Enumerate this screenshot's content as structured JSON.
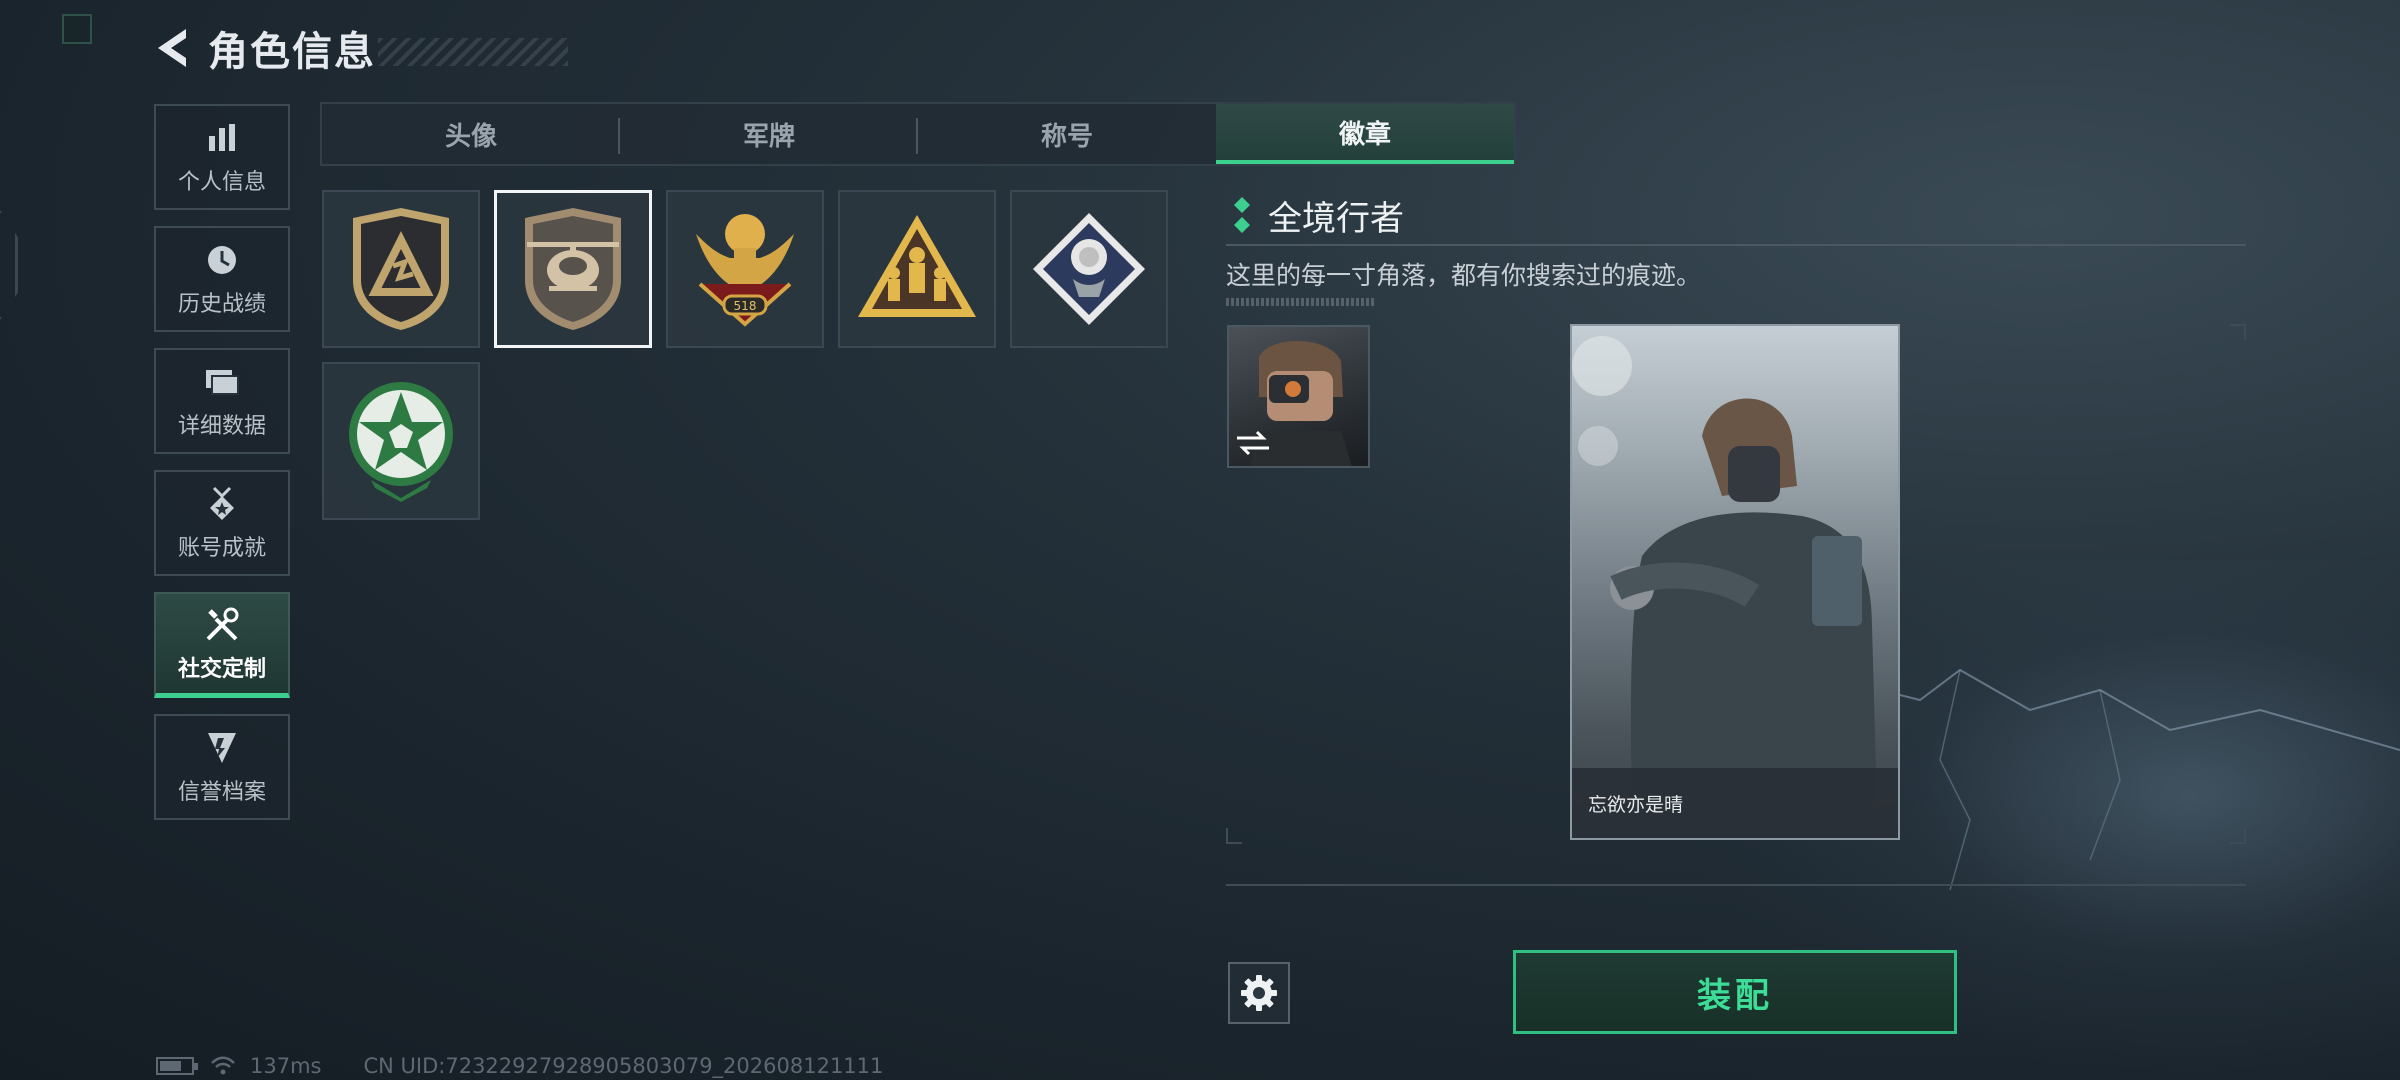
{
  "header": {
    "title": "角色信息"
  },
  "sidebar": {
    "items": [
      {
        "label": "个人信息",
        "icon": "bar-chart-icon",
        "active": false
      },
      {
        "label": "历史战绩",
        "icon": "clock-icon",
        "active": false
      },
      {
        "label": "详细数据",
        "icon": "folder-icon",
        "active": false
      },
      {
        "label": "账号成就",
        "icon": "medal-icon",
        "active": false
      },
      {
        "label": "社交定制",
        "icon": "tools-icon",
        "active": true
      },
      {
        "label": "信誉档案",
        "icon": "shield-icon",
        "active": false
      }
    ]
  },
  "tabs": [
    {
      "label": "头像",
      "active": false
    },
    {
      "label": "军牌",
      "active": false
    },
    {
      "label": "称号",
      "active": false
    },
    {
      "label": "徽章",
      "active": true
    }
  ],
  "badges": [
    {
      "icon": "triangle-shield-badge-icon",
      "selected": false
    },
    {
      "icon": "helicopter-badge-icon",
      "selected": true
    },
    {
      "icon": "eagle-518-badge-icon",
      "badge_text": "518",
      "selected": false
    },
    {
      "icon": "soldiers-triangle-badge-icon",
      "selected": false
    },
    {
      "icon": "rose-diamond-badge-icon",
      "selected": false
    },
    {
      "icon": "green-star-badge-icon",
      "selected": false
    }
  ],
  "detail": {
    "badge_name": "全境行者",
    "badge_description": "这里的每一寸角落，都有你搜索过的痕迹。",
    "card_player_name": "忘欲亦是晴",
    "equip_label": "装配"
  },
  "status_bar": {
    "battery_level": 0.7,
    "ping": "137ms",
    "uid": "CN UID:72322927928905803079_202608121111"
  },
  "colors": {
    "accent": "#3ccf8e",
    "background": "#1b252d",
    "gold": "#c9a24a"
  }
}
